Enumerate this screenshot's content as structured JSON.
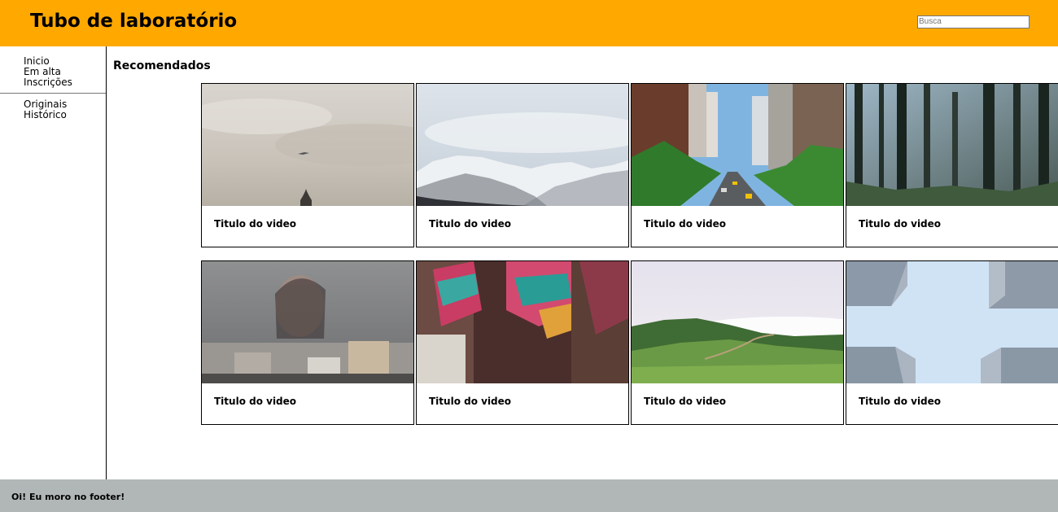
{
  "header": {
    "title": "Tubo de laboratório",
    "search_placeholder": "Busca",
    "background_color": "#ffa800"
  },
  "sidebar": {
    "items": [
      {
        "label": "Inicio"
      },
      {
        "label": "Em alta"
      },
      {
        "label": "Inscrições"
      }
    ],
    "secondary_items": [
      {
        "label": "Originais"
      },
      {
        "label": "Histórico"
      }
    ]
  },
  "main": {
    "section_title": "Recomendados",
    "videos": [
      {
        "title": "Titulo do video",
        "thumbnail": "sky-with-airplane"
      },
      {
        "title": "Titulo do video",
        "thumbnail": "snowy-mountains"
      },
      {
        "title": "Titulo do video",
        "thumbnail": "city-avenue"
      },
      {
        "title": "Titulo do video",
        "thumbnail": "forest-trees"
      },
      {
        "title": "Titulo do video",
        "thumbnail": "woman-behind-window"
      },
      {
        "title": "Titulo do video",
        "thumbnail": "colorful-scarf"
      },
      {
        "title": "Titulo do video",
        "thumbnail": "green-hills"
      },
      {
        "title": "Titulo do video",
        "thumbnail": "buildings-looking-up"
      }
    ]
  },
  "footer": {
    "text": "Oi! Eu moro no footer!",
    "background_color": "#b1b7b6"
  }
}
